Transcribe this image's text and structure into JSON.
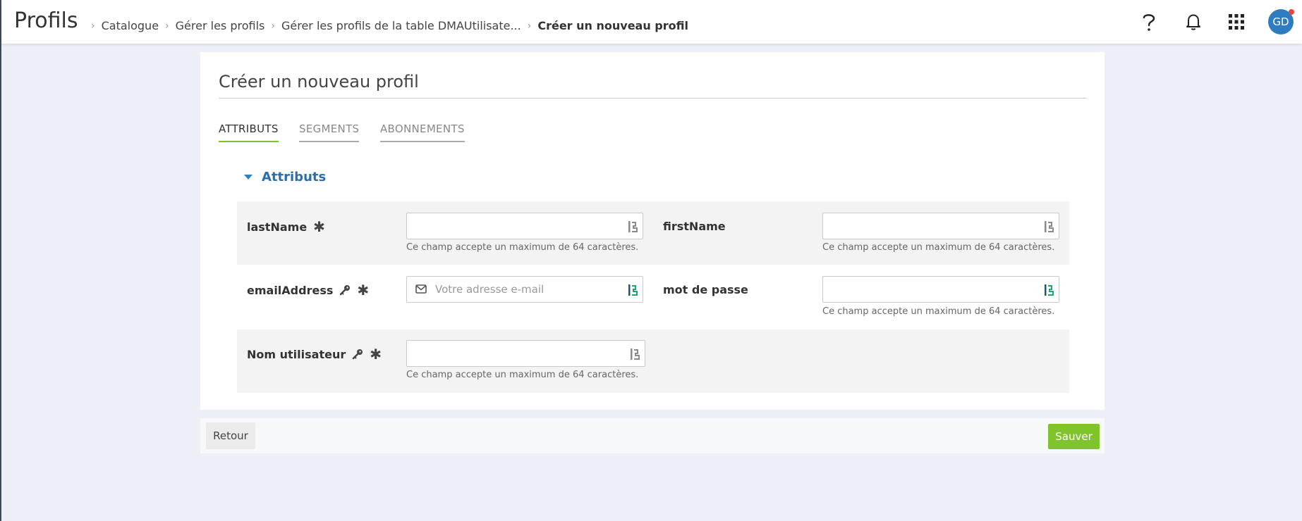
{
  "header": {
    "app_title": "Profils",
    "breadcrumb": [
      "Catalogue",
      "Gérer les profils",
      "Gérer les profils de la table DMAUtilisate..."
    ],
    "breadcrumb_current": "Créer un nouveau profil",
    "icons": [
      "help-icon",
      "bell-icon",
      "apps-grid-icon"
    ],
    "avatar_initials": "GD",
    "notification_dot_color": "#e8453c"
  },
  "page": {
    "title": "Créer un nouveau profil",
    "tabs": [
      {
        "label": "ATTRIBUTS",
        "active": true
      },
      {
        "label": "SEGMENTS",
        "active": false
      },
      {
        "label": "ABONNEMENTS",
        "active": false
      }
    ],
    "section_title": "Attributs"
  },
  "fields": {
    "lastName": {
      "label": "lastName",
      "required": "✱",
      "value": "",
      "hint": "Ce champ accepte un maximum de 64 caractères."
    },
    "firstName": {
      "label": "firstName",
      "value": "",
      "hint": "Ce champ accepte un maximum de 64 caractères."
    },
    "emailAddress": {
      "label": "emailAddress",
      "required": "✱",
      "placeholder": "Votre adresse e-mail"
    },
    "password": {
      "label": "mot de passe",
      "value": "",
      "hint": "Ce champ accepte un maximum de 64 caractères."
    },
    "username": {
      "label": "Nom utilisateur",
      "required": "✱",
      "value": "",
      "hint": "Ce champ accepte un maximum de 64 caractères."
    }
  },
  "footer": {
    "back_label": "Retour",
    "save_label": "Sauver"
  },
  "colors": {
    "accent_green": "#7ec42a",
    "link_blue": "#2b6ea8",
    "avatar_blue": "#2e7dc2"
  }
}
